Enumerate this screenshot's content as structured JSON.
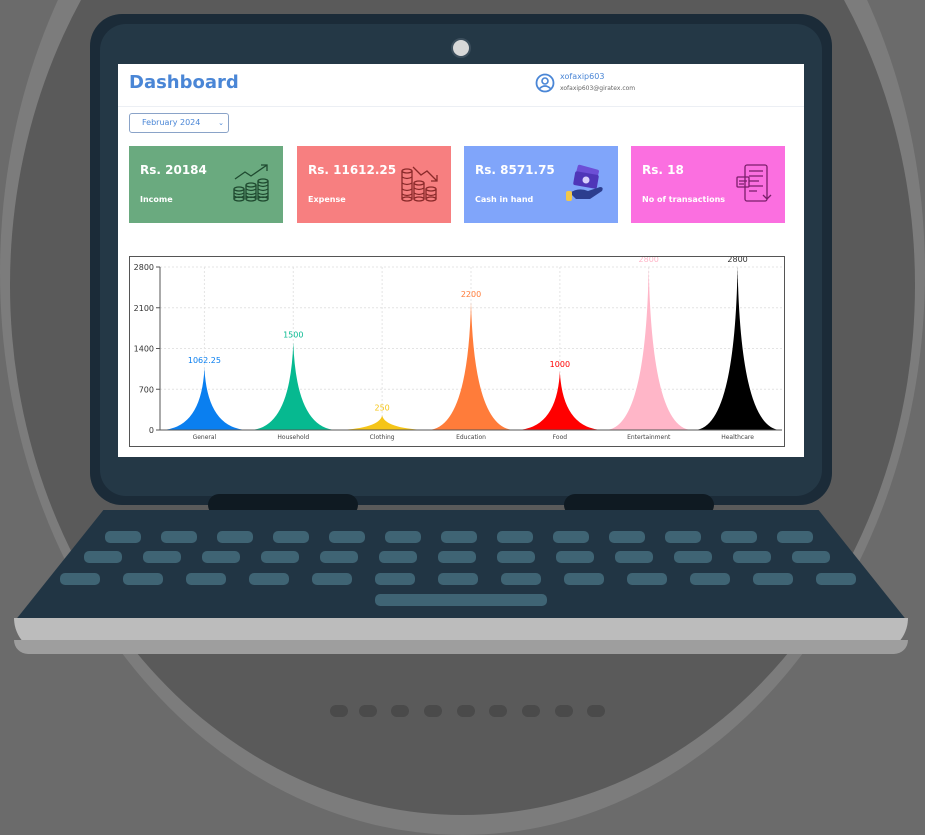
{
  "header": {
    "title": "Dashboard",
    "username": "xofaxip603",
    "email": "xofaxip603@giratex.com"
  },
  "filter": {
    "month": "February 2024"
  },
  "cards": [
    {
      "amount": "Rs. 20184",
      "label": "Income",
      "color": "#6aaa7f",
      "icon": "growth-coins-icon"
    },
    {
      "amount": "Rs. 11612.25",
      "label": "Expense",
      "color": "#f77f80",
      "icon": "decline-coins-icon"
    },
    {
      "amount": "Rs. 8571.75",
      "label": "Cash in hand",
      "color": "#80a5fa",
      "icon": "cash-hand-icon"
    },
    {
      "amount": "Rs. 18",
      "label": "No of transactions",
      "color": "#fb6fe0",
      "icon": "receipt-icon"
    }
  ],
  "chart_data": {
    "type": "area",
    "categories": [
      "General",
      "Household",
      "Clothing",
      "Education",
      "Food",
      "Entertainment",
      "Healthcare"
    ],
    "values": [
      1062.25,
      1500,
      250,
      2200,
      1000,
      2800,
      2800
    ],
    "value_labels": [
      "1062.25",
      "1500",
      "250",
      "2200",
      "1000",
      "2800",
      "2800"
    ],
    "colors": [
      "#0a7ff0",
      "#06b990",
      "#f5c518",
      "#ff7c3a",
      "#ff0000",
      "#ffb6c8",
      "#000000"
    ],
    "yticks": [
      "0",
      "700",
      "1400",
      "2100",
      "2800"
    ],
    "ylim": [
      0,
      2800
    ],
    "grid": true,
    "legend": "none"
  }
}
